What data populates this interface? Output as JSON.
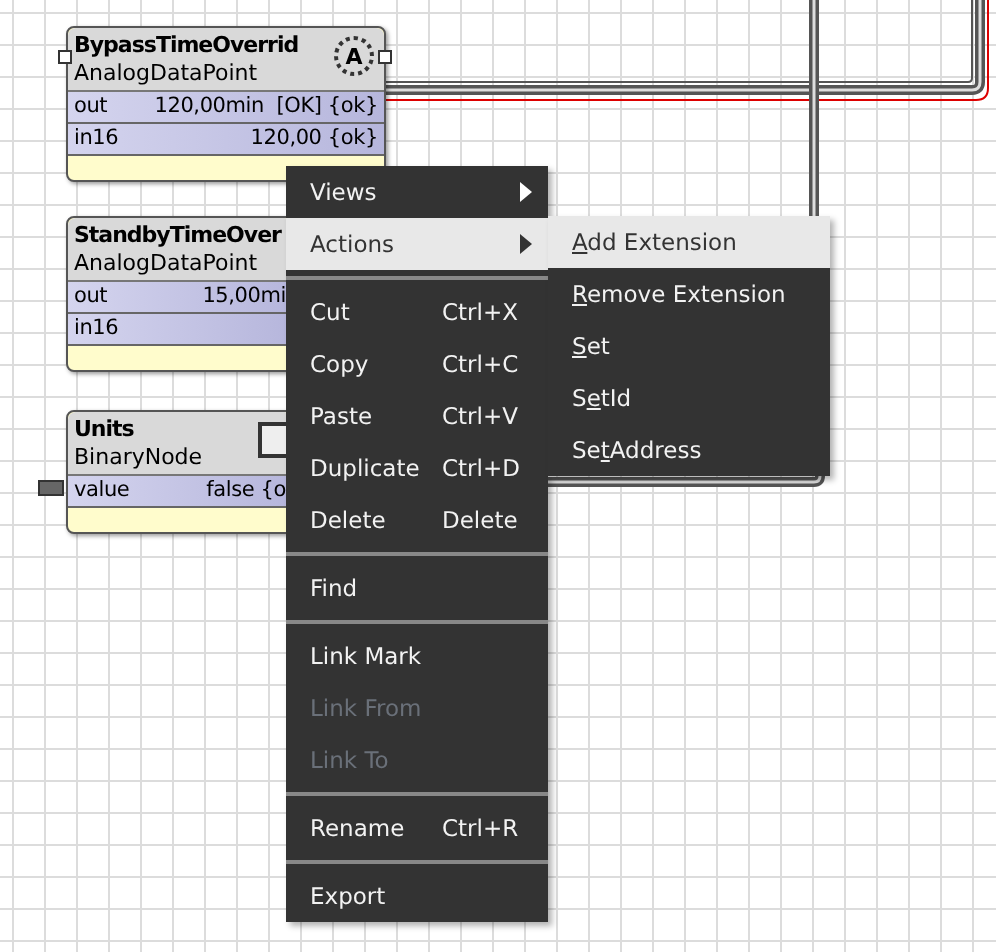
{
  "nodes": [
    {
      "title": "BypassTimeOverrid",
      "type": "AnalogDataPoint",
      "icon_text": "A",
      "slots": [
        {
          "name": "out",
          "value": "120,00min  [OK] {ok}"
        },
        {
          "name": "in16",
          "value": "120,00 {ok}"
        }
      ]
    },
    {
      "title": "StandbyTimeOver",
      "type": "AnalogDataPoint",
      "slots": [
        {
          "name": "out",
          "value": "15,00mi"
        },
        {
          "name": "in16"
        }
      ]
    },
    {
      "title": "Units",
      "type": "BinaryNode",
      "slots": [
        {
          "name": "value",
          "value": "false {o"
        }
      ]
    }
  ],
  "context_menu": [
    {
      "kind": "item",
      "label": {
        "before": "Views"
      },
      "submenu": true,
      "selected": false,
      "disabled": false
    },
    {
      "kind": "item",
      "label": {
        "before": "Actions"
      },
      "submenu": true,
      "selected": true,
      "disabled": false
    },
    {
      "kind": "separator"
    },
    {
      "kind": "item",
      "label": {
        "before": "Cut"
      },
      "shortcut": "Ctrl+X",
      "selected": false,
      "disabled": false
    },
    {
      "kind": "item",
      "label": {
        "before": "Copy"
      },
      "shortcut": "Ctrl+C",
      "selected": false,
      "disabled": false
    },
    {
      "kind": "item",
      "label": {
        "before": "Paste"
      },
      "shortcut": "Ctrl+V",
      "selected": false,
      "disabled": false
    },
    {
      "kind": "item",
      "label": {
        "before": "Duplicate"
      },
      "shortcut": "Ctrl+D",
      "selected": false,
      "disabled": false
    },
    {
      "kind": "item",
      "label": {
        "before": "Delete"
      },
      "shortcut": "Delete",
      "selected": false,
      "disabled": false
    },
    {
      "kind": "separator"
    },
    {
      "kind": "item",
      "label": {
        "before": "Find"
      },
      "selected": false,
      "disabled": false
    },
    {
      "kind": "separator"
    },
    {
      "kind": "item",
      "label": {
        "before": "Link Mark"
      },
      "selected": false,
      "disabled": false
    },
    {
      "kind": "item",
      "label": {
        "before": "Link From"
      },
      "selected": false,
      "disabled": true
    },
    {
      "kind": "item",
      "label": {
        "before": "Link To"
      },
      "selected": false,
      "disabled": true
    },
    {
      "kind": "separator"
    },
    {
      "kind": "item",
      "label": {
        "before": "Rename"
      },
      "shortcut": "Ctrl+R",
      "selected": false,
      "disabled": false
    },
    {
      "kind": "separator"
    },
    {
      "kind": "item",
      "label": {
        "before": "Export"
      },
      "selected": false,
      "disabled": false
    }
  ],
  "actions_submenu": [
    {
      "label": {
        "key": "A",
        "after": "dd Extension"
      },
      "selected": true
    },
    {
      "label": {
        "key": "R",
        "after": "emove Extension"
      },
      "selected": false
    },
    {
      "label": {
        "key": "S",
        "after": "et"
      },
      "selected": false
    },
    {
      "label": {
        "before": "S",
        "key": "e",
        "after": "tId"
      },
      "selected": false
    },
    {
      "label": {
        "before": "Se",
        "key": "t",
        "after": "Address"
      },
      "selected": false
    }
  ]
}
